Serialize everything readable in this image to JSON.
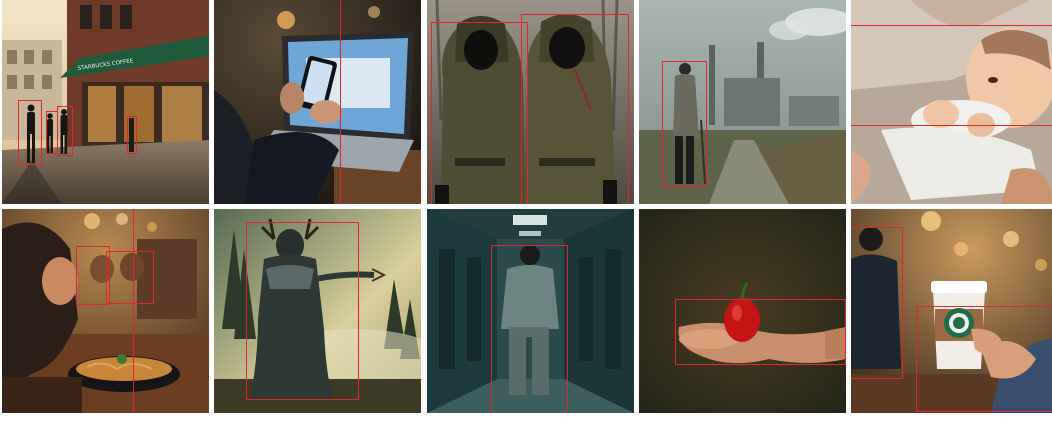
{
  "grid": {
    "rows": 2,
    "cols": 5,
    "box_color": "#e0282c"
  },
  "tiles": [
    {
      "scene": "street-storefront-pedestrians",
      "sign_text": "STARBUCKS COFFEE",
      "boxes": 4
    },
    {
      "scene": "hands-phone-laptop",
      "boxes": 1
    },
    {
      "scene": "two-hooded-masked-figures",
      "boxes": 2
    },
    {
      "scene": "person-walking-toward-factory",
      "boxes": 1
    },
    {
      "scene": "baby-held-by-adult",
      "boxes": 1
    },
    {
      "scene": "woman-with-noodle-bowl-cafe",
      "boxes": 3
    },
    {
      "scene": "antlered-creature-in-misty-forest",
      "boxes": 1
    },
    {
      "scene": "man-in-hospital-corridor",
      "boxes": 1
    },
    {
      "scene": "hand-holding-red-pepper",
      "boxes": 1
    },
    {
      "scene": "hand-holding-coffee-cup",
      "boxes": 2
    }
  ]
}
